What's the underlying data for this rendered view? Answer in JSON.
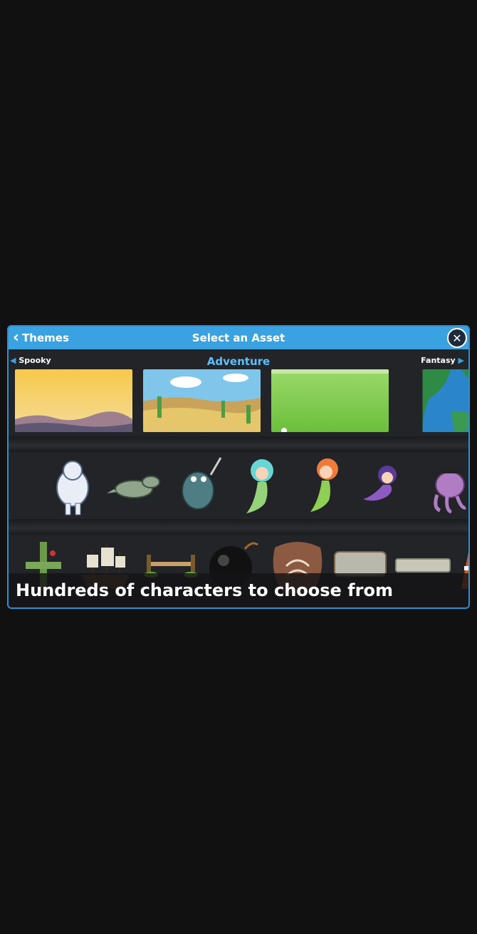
{
  "dialog": {
    "title": "Select an Asset",
    "back_label": "Themes",
    "close_icon": "close-icon"
  },
  "theme_nav": {
    "previous": "Spooky",
    "current": "Adventure",
    "next": "Fantasy"
  },
  "backgrounds": [
    "desert-sunset",
    "cactus-desert",
    "green-meadow",
    "island-map"
  ],
  "characters": [
    "yeti",
    "dinosaur",
    "sea-monster",
    "blue-mermaid",
    "red-mermaid",
    "purple-mermaid",
    "pirate-octopus"
  ],
  "props": [
    "biplane",
    "pirate-ship",
    "rope-bridge",
    "bomb",
    "fossil",
    "stone-block",
    "stone-slab",
    "traffic-cone"
  ],
  "caption": "Hundreds of characters to choose from",
  "colors": {
    "accent": "#3aa2e0",
    "theme_title": "#5cc0ff",
    "panel": "#222428"
  }
}
